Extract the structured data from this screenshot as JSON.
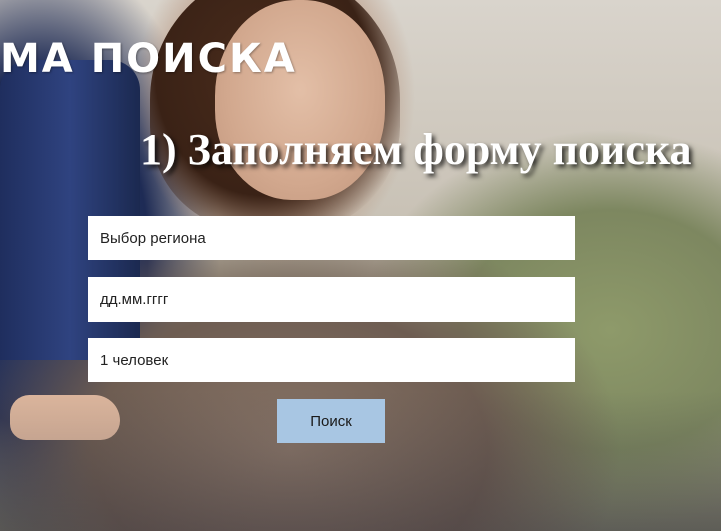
{
  "header": {
    "title": "МА ПОИСКА",
    "step_title": "1) Заполняем форму поиска"
  },
  "form": {
    "region_placeholder": "Выбор региона",
    "date_placeholder": "дд.мм.гггг",
    "people_value": "1 человек",
    "search_label": "Поиск"
  },
  "colors": {
    "button_bg": "#a8c6e3",
    "field_bg": "#ffffff",
    "heading_text": "#ffffff"
  }
}
